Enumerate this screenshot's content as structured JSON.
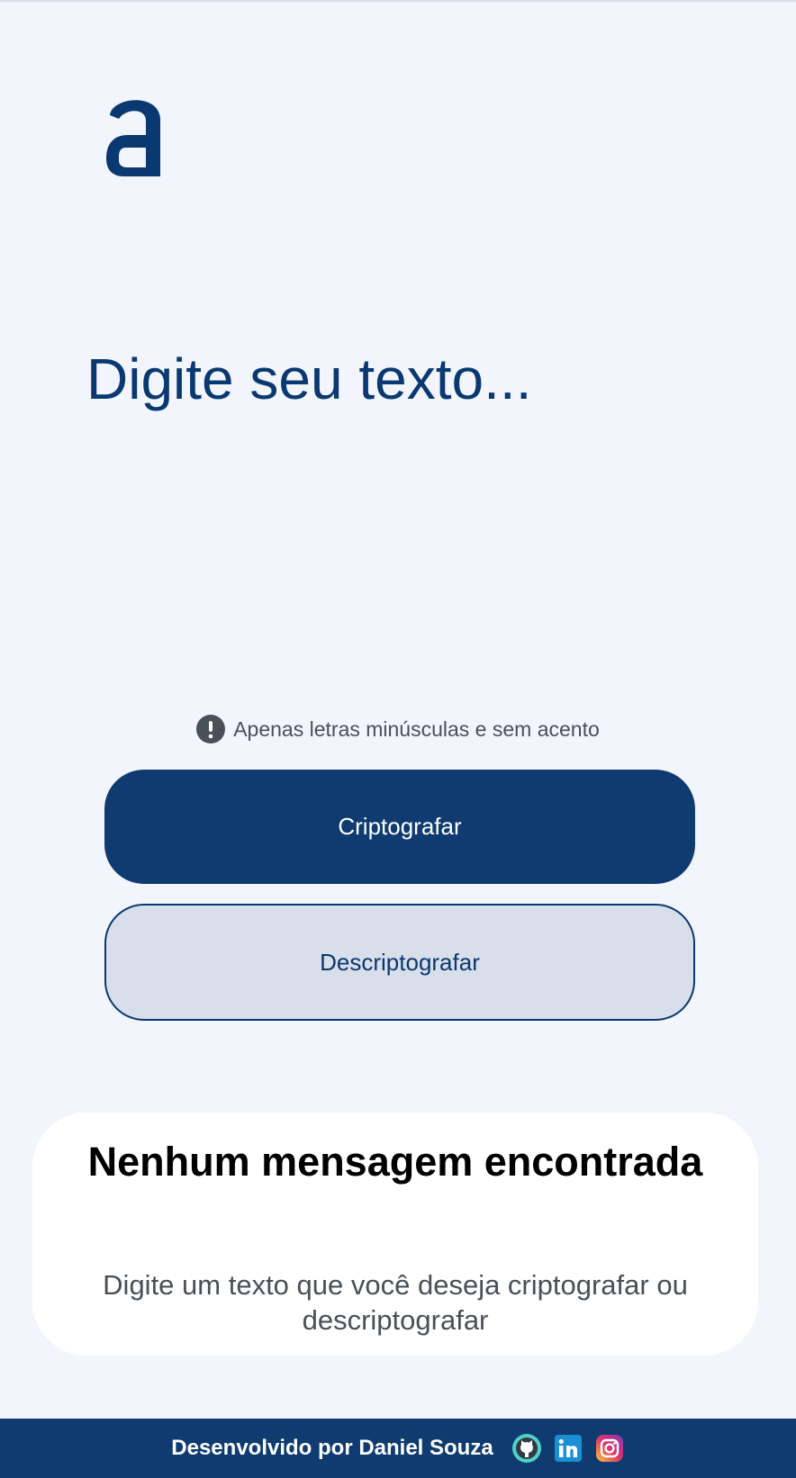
{
  "logo": {
    "name": "alura-logo-icon",
    "color": "#0a3871"
  },
  "input": {
    "placeholder": "Digite seu texto..."
  },
  "hint": {
    "icon": "exclamation-circle-icon",
    "text": "Apenas letras minúsculas e sem acento"
  },
  "buttons": {
    "encrypt_label": "Criptografar",
    "decrypt_label": "Descriptografar"
  },
  "output": {
    "title": "Nenhum mensagem encontrada",
    "text": "Digite um texto que você deseja criptografar ou descriptografar"
  },
  "footer": {
    "text": "Desenvolvido por Daniel Souza",
    "links": [
      {
        "icon": "github-icon"
      },
      {
        "icon": "linkedin-icon"
      },
      {
        "icon": "instagram-icon"
      }
    ]
  },
  "colors": {
    "background": "#f2f5fc",
    "primary": "#0a3871",
    "button_primary": "#0f3b70",
    "button_secondary": "#d8dfea",
    "text_muted": "#495057",
    "footer": "#0f3b70"
  }
}
